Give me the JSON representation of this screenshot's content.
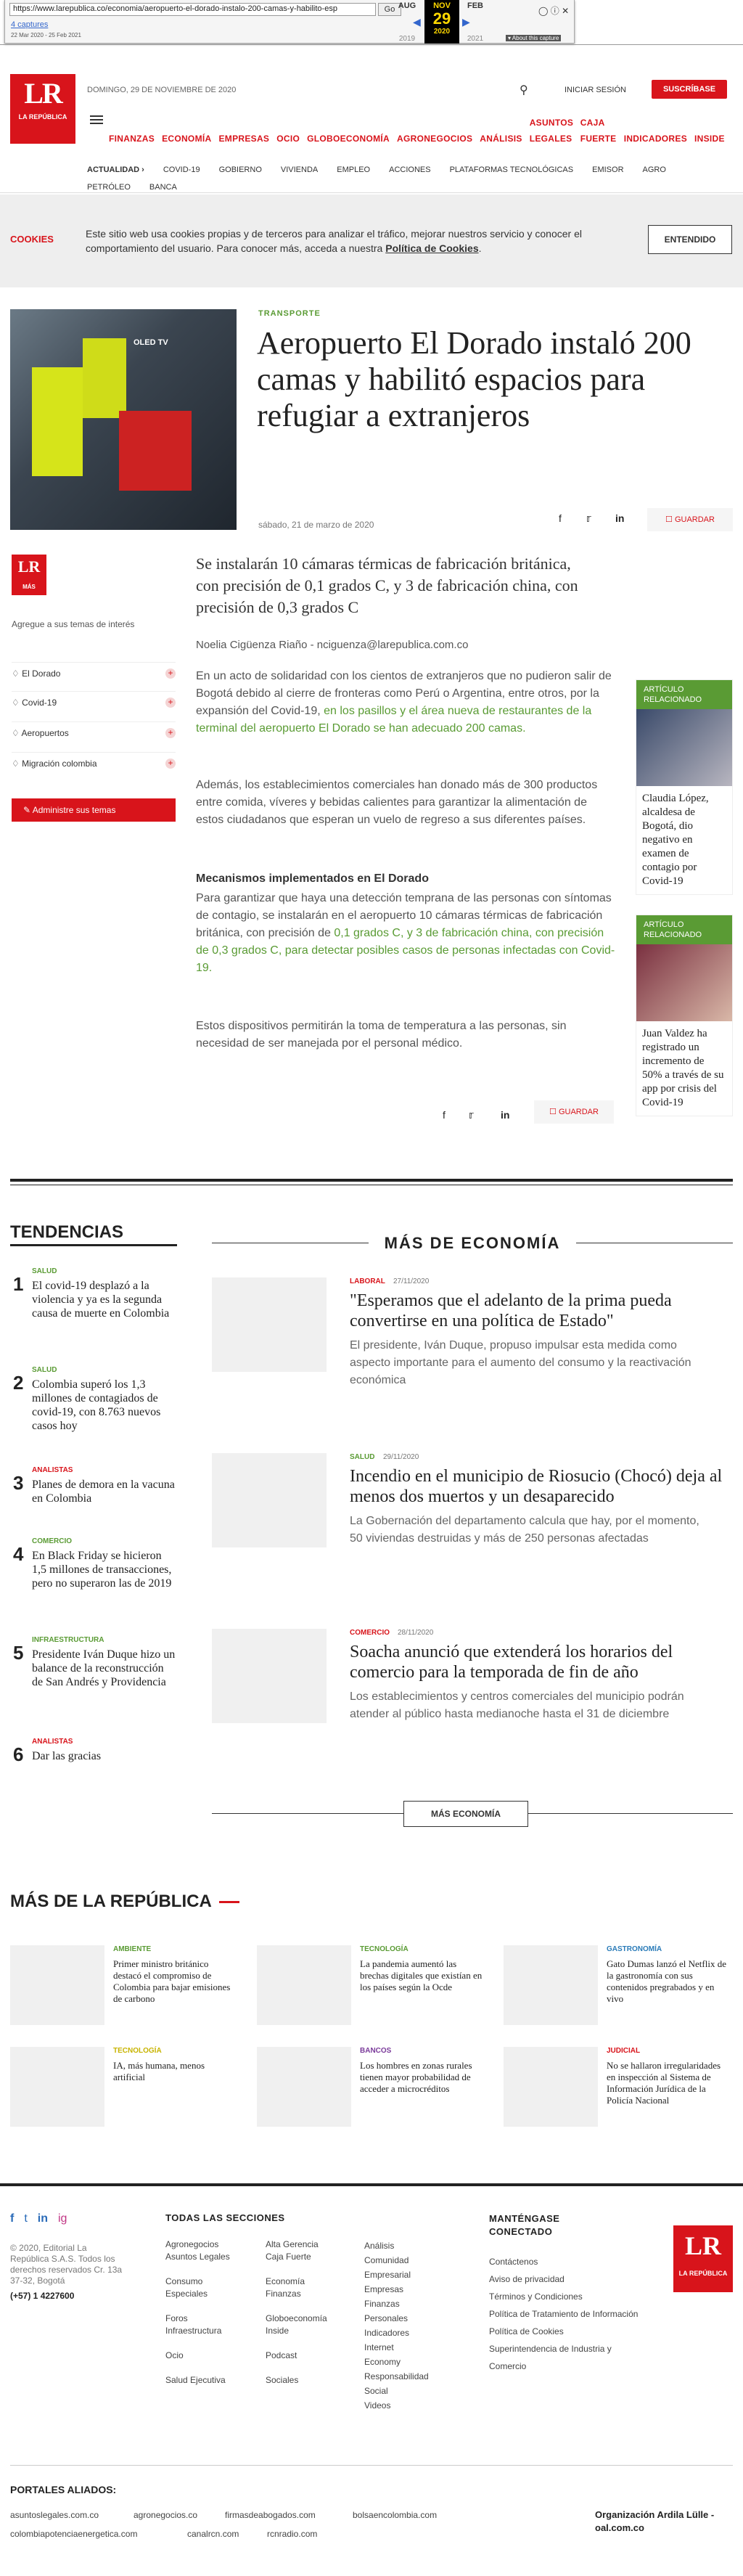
{
  "wayback": {
    "url": "https://www.larepublica.co/economia/aeropuerto-el-dorado-instalo-200-camas-y-habilito-esp",
    "go": "Go",
    "captures": "4 captures",
    "range": "22 Mar 2020 - 25 Feb 2021",
    "months": [
      "AUG",
      "NOV",
      "FEB"
    ],
    "day": "29",
    "years": [
      "2019",
      "2020",
      "2021"
    ],
    "about": "▾ About this capture"
  },
  "header": {
    "logo": "LR",
    "logo_sub": "LA REPÚBLICA",
    "date": "DOMINGO, 29 DE NOVIEMBRE DE 2020",
    "login": "INICIAR SESIÓN",
    "subscribe": "SUSCRÍBASE",
    "sections": [
      "FINANZAS",
      "ECONOMÍA",
      "EMPRESAS",
      "OCIO",
      "GLOBOECONOMÍA",
      "AGRONEGOCIOS",
      "ANÁLISIS",
      "ASUNTOS LEGALES",
      "CAJA FUERTE",
      "INDICADORES",
      "INSIDE"
    ],
    "subnav": [
      "ACTUALIDAD",
      "COVID-19",
      "GOBIERNO",
      "VIVIENDA",
      "EMPLEO",
      "ACCIONES",
      "PLATAFORMAS TECNOLÓGICAS",
      "EMISOR",
      "AGRO",
      "PETRÓLEO",
      "BANCA"
    ]
  },
  "cookies": {
    "title": "COOKIES",
    "text": "Este sitio web usa cookies propias y de terceros para analizar el tráfico, mejorar nuestros servicio y conocer el comportamiento del usuario. Para conocer más, acceda a nuestra",
    "policy": "Política de Cookies",
    "button": "ENTENDIDO"
  },
  "article": {
    "kicker": "TRANSPORTE",
    "image_text": "OLED TV",
    "title": "Aeropuerto El Dorado instaló 200 camas y habilitó espacios para refugiar a extranjeros",
    "date": "sábado, 21 de marzo de 2020",
    "save": "GUARDAR",
    "lead": "Se instalarán 10 cámaras térmicas de fabricación británica, con precisión de 0,1 grados C, y 3 de fabricación china, con precisión de 0,3 grados C",
    "author": "Noelia Cigüenza Riaño - nciguenza@larepublica.com.co",
    "p1a": "En un acto de solidaridad con los cientos de extranjeros que no pudieron salir de Bogotá debido al cierre de fronteras como Perú o Argentina, entre otros, por la expansión del Covid-19,",
    "p1b": "en los pasillos y el área nueva de restaurantes de la terminal del aeropuerto El Dorado se han adecuado 200 camas.",
    "p2": "Además, los establecimientos comerciales han donado más de 300 productos entre comida, víveres y bebidas calientes para garantizar la alimentación de estos ciudadanos que esperan un vuelo de regreso a sus diferentes países.",
    "h3": "Mecanismos implementados en El Dorado",
    "p3a": "Para garantizar que haya una detección temprana de las personas con síntomas de contagio, se instalarán en el aeropuerto 10 cámaras térmicas de fabricación británica, con precisión de",
    "p3b": "0,1 grados C, y 3 de fabricación china, con precisión de 0,3 grados C, para detectar posibles casos de personas infectadas con Covid-19.",
    "p4": "Estos dispositivos permitirán la toma de temperatura a las personas, sin necesidad de ser manejada por el personal médico."
  },
  "sidebar": {
    "logo": "LR",
    "logo_sub": "MÁS",
    "add_text": "Agregue a sus temas de interés",
    "tags": [
      "El Dorado",
      "Covid-19",
      "Aeropuertos",
      "Migración colombia"
    ],
    "admin": "Administre sus temas"
  },
  "related": [
    {
      "label": "ARTÍCULO RELACIONADO",
      "title": "Claudia López, alcaldesa de Bogotá, dio negativo en examen de contagio por Covid-19"
    },
    {
      "label": "ARTÍCULO RELACIONADO",
      "title": "Juan Valdez ha registrado un incremento de 50% a través de su app por crisis del Covid-19"
    }
  ],
  "tendencias": {
    "title": "TENDENCIAS",
    "items": [
      {
        "n": "1",
        "cat": "SALUD",
        "title": "El covid-19 desplazó a la violencia y ya es la segunda causa de muerte en Colombia"
      },
      {
        "n": "2",
        "cat": "SALUD",
        "title": "Colombia superó los 1,3 millones de contagiados de covid-19, con 8.763 nuevos casos hoy"
      },
      {
        "n": "3",
        "cat": "ANALISTAS",
        "title": "Planes de demora en la vacuna en Colombia"
      },
      {
        "n": "4",
        "cat": "COMERCIO",
        "title": "En Black Friday se hicieron 1,5 millones de transacciones, pero no superaron las de 2019"
      },
      {
        "n": "5",
        "cat": "INFRAESTRUCTURA",
        "title": "Presidente Iván Duque hizo un balance de la reconstrucción de San Andrés y Providencia"
      },
      {
        "n": "6",
        "cat": "ANALISTAS",
        "title": "Dar las gracias"
      }
    ]
  },
  "economia": {
    "title": "MÁS DE ECONOMÍA",
    "button": "MÁS ECONOMÍA",
    "items": [
      {
        "cat": "LABORAL",
        "date": "27/11/2020",
        "title": "\"Esperamos que el adelanto de la prima pueda convertirse en una política de Estado\"",
        "summary": "El presidente, Iván Duque, propuso impulsar esta medida como aspecto importante para el aumento del consumo y la reactivación económica"
      },
      {
        "cat": "SALUD",
        "date": "29/11/2020",
        "title": "Incendio en el municipio de Riosucio (Chocó) deja al menos dos muertos y un desaparecido",
        "summary": "La Gobernación del departamento calcula que hay, por el momento, 50 viviendas destruidas y más de 250 personas afectadas"
      },
      {
        "cat": "COMERCIO",
        "date": "28/11/2020",
        "title": "Soacha anunció que extenderá los horarios del comercio para la temporada de fin de año",
        "summary": "Los establecimientos y centros comerciales del municipio podrán atender al público hasta medianoche hasta el 31 de diciembre"
      }
    ]
  },
  "republica": {
    "title": "MÁS DE LA REPÚBLICA",
    "items": [
      {
        "cat": "AMBIENTE",
        "color": "#5a9b34",
        "title": "Primer ministro británico destacó el compromiso de Colombia para bajar emisiones de carbono"
      },
      {
        "cat": "TECNOLOGÍA",
        "color": "#5a9b34",
        "title": "La pandemia aumentó las brechas digitales que existían en los países según la Ocde"
      },
      {
        "cat": "GASTRONOMÍA",
        "color": "#2a7bb8",
        "title": "Gato Dumas lanzó el Netflix de la gastronomía con sus contenidos pregrabados y en vivo"
      },
      {
        "cat": "TECNOLOGÍA",
        "color": "#c8b400",
        "title": "IA, más humana, menos artificial"
      },
      {
        "cat": "BANCOS",
        "color": "#7a3a9a",
        "title": "Los hombres en zonas rurales tienen mayor probabilidad de acceder a microcréditos"
      },
      {
        "cat": "JUDICIAL",
        "color": "#d8141b",
        "title": "No se hallaron irregularidades en inspección al Sistema de Información Jurídica de la Policía Nacional"
      }
    ]
  },
  "footer": {
    "social": [
      "f",
      "t",
      "in",
      "ig"
    ],
    "copyright": "© 2020, Editorial La República S.A.S. Todos los derechos reservados Cr. 13a 37-32, Bogotá",
    "phone": "(+57) 1 4227600",
    "sections_title": "TODAS LAS SECCIONES",
    "col1": [
      "Agronegocios",
      "Asuntos Legales",
      "",
      "Consumo",
      "Especiales",
      "",
      "Foros",
      "Infraestructura",
      "",
      "Ocio",
      "",
      "Salud Ejecutiva"
    ],
    "col2": [
      "Alta Gerencia",
      "Caja Fuerte",
      "",
      "Economía",
      "Finanzas",
      "",
      "Globoeconomía",
      "Inside",
      "",
      "Podcast",
      "",
      "Sociales"
    ],
    "col3": [
      "Análisis",
      "Comunidad",
      "Empresarial",
      "Empresas",
      "Finanzas",
      "Personales",
      "Indicadores",
      "Internet",
      "Economy",
      "Responsabilidad",
      "Social",
      "Videos"
    ],
    "connect_title": "MANTÉNGASE CONECTADO",
    "connect": [
      "Contáctenos",
      "Aviso de privacidad",
      "Términos y Condiciones",
      "Política de Tratamiento de Información",
      "Política de Cookies",
      "Superintendencia de Industria y Comercio"
    ],
    "logo": "LR",
    "logo_sub": "LA REPÚBLICA",
    "portales_title": "PORTALES ALIADOS:",
    "portales": [
      "asuntoslegales.com.co",
      "agronegocios.co",
      "firmasdeabogados.com",
      "bolsaencolombia.com",
      "colombiapotenciaenergetica.com",
      "canalrcn.com",
      "rcnradio.com"
    ],
    "org": "Organización Ardila Lülle - oal.com.co"
  }
}
